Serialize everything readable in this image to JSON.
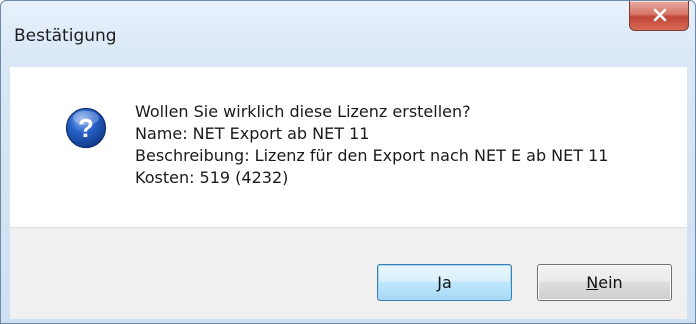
{
  "window": {
    "title": "Bestätigung"
  },
  "message": {
    "question": "Wollen Sie wirklich diese Lizenz erstellen?",
    "name_line": "Name: NET Export ab NET 11",
    "description_line": "Beschreibung: Lizenz für den Export nach NET E ab NET 11",
    "cost_line": "Kosten: 519 (4232)"
  },
  "buttons": {
    "yes_label": "Ja",
    "no_mnemonic": "N",
    "no_rest": "ein"
  },
  "icons": {
    "close": "close-icon",
    "question": "question-icon"
  },
  "colors": {
    "close_red": "#c1463a",
    "question_blue": "#2a62c9",
    "default_button_border": "#3c7fb1"
  }
}
